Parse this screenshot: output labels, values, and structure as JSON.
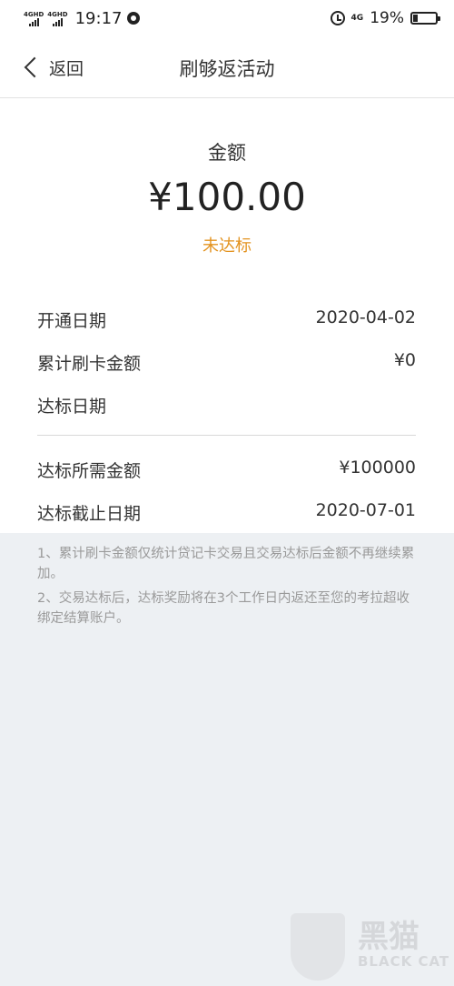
{
  "status_bar": {
    "sim1_tag": "4GHD",
    "sim2_tag": "4GHD",
    "time": "19:17",
    "network": "4G",
    "battery": "19%",
    "battery_level": 0.19
  },
  "nav": {
    "back_label": "返回",
    "title": "刷够返活动"
  },
  "summary": {
    "amount_label": "金额",
    "amount_value": "¥100.00",
    "status": "未达标",
    "status_color": "#e39320"
  },
  "details": [
    {
      "label": "开通日期",
      "value": "2020-04-02"
    },
    {
      "label": "累计刷卡金额",
      "value": "¥0"
    },
    {
      "label": "达标日期",
      "value": ""
    }
  ],
  "requirements": [
    {
      "label": "达标所需金额",
      "value": "¥100000"
    },
    {
      "label": "达标截止日期",
      "value": "2020-07-01"
    }
  ],
  "notes": [
    "1、累计刷卡金额仅统计贷记卡交易且交易达标后金额不再继续累加。",
    "2、交易达标后，达标奖励将在3个工作日内返还至您的考拉超收绑定结算账户。"
  ],
  "watermark": {
    "text_cn": "黑猫",
    "text_en": "BLACK CAT"
  }
}
